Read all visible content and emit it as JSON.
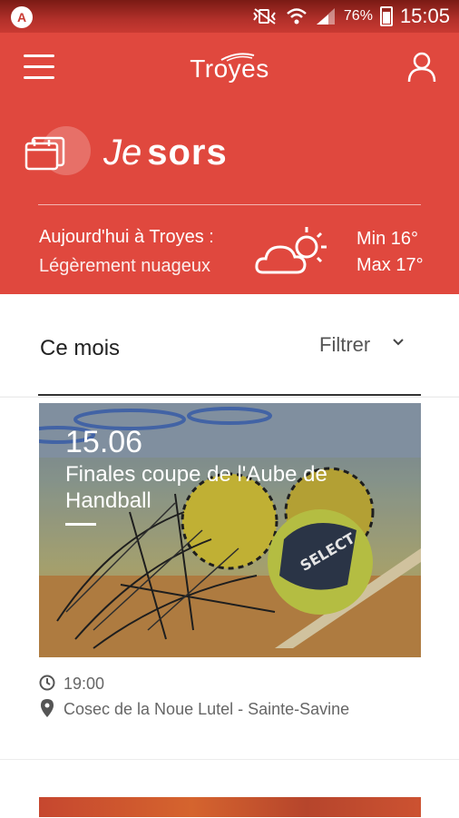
{
  "status_bar": {
    "app_badge": "A",
    "battery": "76%",
    "time": "15:05"
  },
  "header": {
    "logo_text": "Troyes"
  },
  "section": {
    "title_je": "Je",
    "title_sors": "sors"
  },
  "weather": {
    "label": "Aujourd'hui à Troyes :",
    "condition": "Légèrement nuageux",
    "icon": "partly-cloudy-icon",
    "min": "Min 16°",
    "max": "Max 17°"
  },
  "month": {
    "title": "Ce mois",
    "filter_label": "Filtrer"
  },
  "events": [
    {
      "date": "15.06",
      "title": "Finales coupe de l'Aube de Handball",
      "time": "19:00",
      "place": "Cosec de la Noue Lutel - Sainte-Savine"
    }
  ],
  "colors": {
    "brand_red": "#e0483e"
  }
}
